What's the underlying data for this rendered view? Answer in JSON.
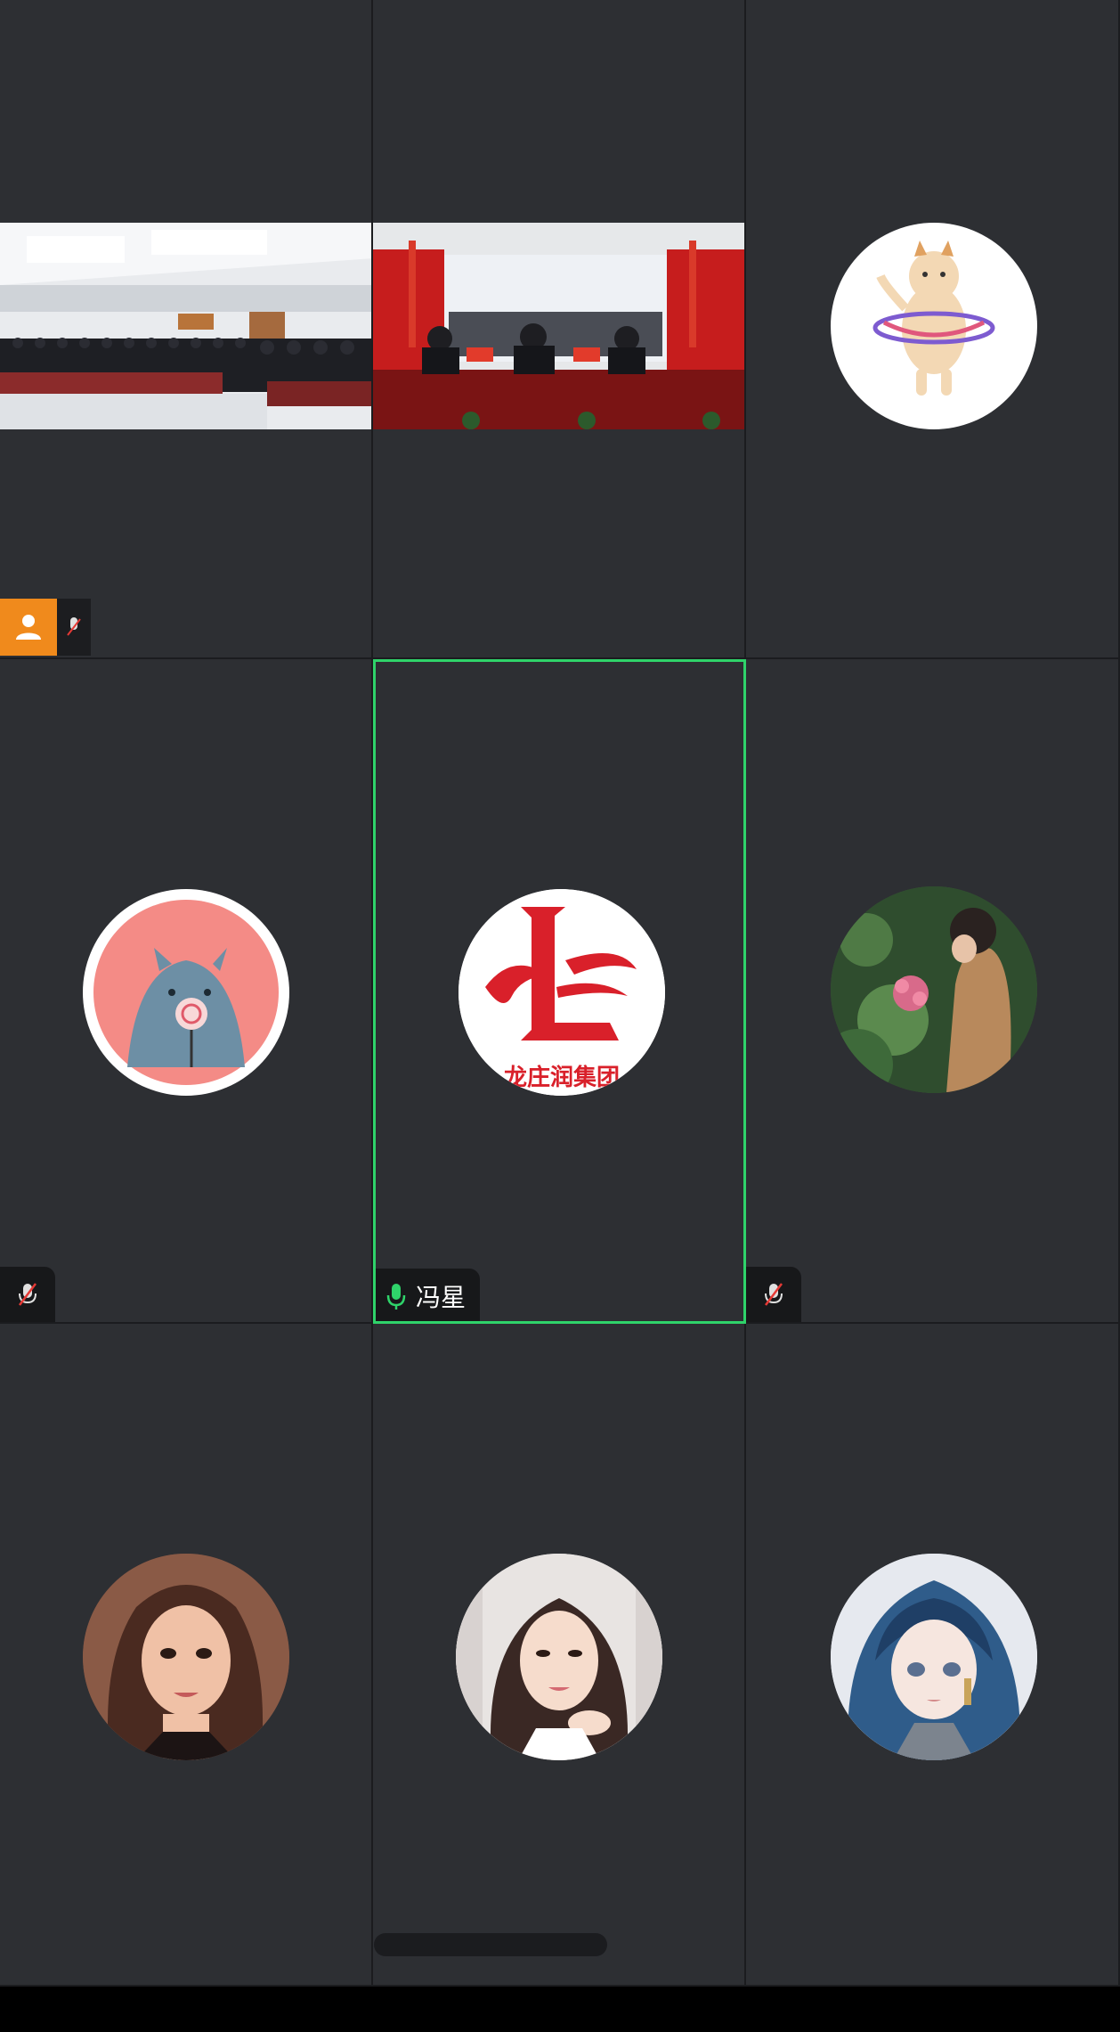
{
  "meeting": {
    "active_speaker": {
      "name": "冯星",
      "mic": "on"
    },
    "participants": [
      {
        "tile": "r1c1",
        "media": "video",
        "scene": "conference-hall-audience",
        "mic": "off",
        "host": true
      },
      {
        "tile": "r1c2",
        "media": "video",
        "scene": "stage-with-flags"
      },
      {
        "tile": "r1c3",
        "media": "avatar",
        "avatar": "cat-hula-hoop"
      },
      {
        "tile": "r2c1",
        "media": "avatar",
        "avatar": "monster-lollipop",
        "mic": "off"
      },
      {
        "tile": "r2c2",
        "media": "avatar",
        "avatar": "company-logo",
        "mic": "on",
        "active": true
      },
      {
        "tile": "r2c3",
        "media": "avatar",
        "avatar": "woman-with-flowers",
        "mic": "off"
      },
      {
        "tile": "r3c1",
        "media": "avatar",
        "avatar": "illustrated-woman"
      },
      {
        "tile": "r3c2",
        "media": "avatar",
        "avatar": "photo-woman"
      },
      {
        "tile": "r3c3",
        "media": "avatar",
        "avatar": "anime-girl-blue-hair"
      }
    ]
  },
  "logo": {
    "text": "龙庄润集团",
    "brand_color": "#d9202a"
  },
  "colors": {
    "tile_bg": "#2d2f33",
    "active_border": "#2fd36a",
    "host_badge": "#f08a1c",
    "mic_on": "#2fd36a"
  },
  "icons": {
    "top_button": "layout-switch-icon",
    "host": "person-icon",
    "mic_on": "microphone-icon",
    "mic_off": "microphone-muted-icon"
  }
}
